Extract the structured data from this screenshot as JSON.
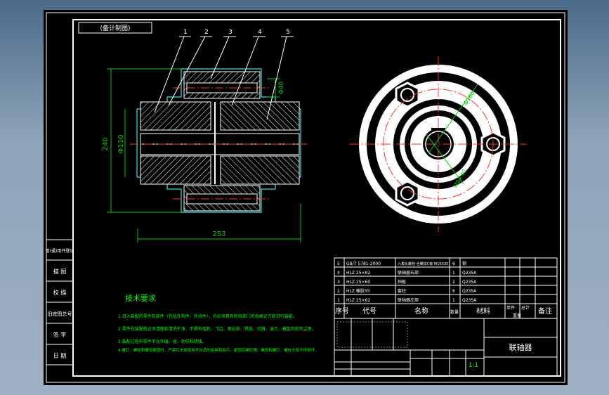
{
  "title_tab": "(备计制图)",
  "balloons": [
    "1",
    "2",
    "3",
    "4",
    "5"
  ],
  "dims": {
    "overall_dia": "240",
    "bore": "Φ110",
    "length": "253",
    "hub": "Φ40",
    "circle": "Φ160",
    "hole": "M8×40"
  },
  "left_stamps": [
    "借(通)用件登记",
    "描 图",
    "校 描",
    "旧底图总号",
    "签 字",
    "日 期"
  ],
  "tech": {
    "heading": "技术要求",
    "lines": [
      "1.进入装配的零件及部件（包括外购件、外协件），均必须具有检验部门的合格证方能进行装配。",
      "2.零件在装配前必须清理和清洗干净，不得有毛刺、飞边、氧化皮、锈蚀、切屑、油污、着色剂和灰尘等。",
      "3.装配过程中零件不允许磕、碰、划伤和锈蚀。",
      "4.螺钉、螺栓和螺母紧固时，严禁打击或使用不合适的旋具和扳手。紧固后螺钉槽、螺母和螺钉、螺栓头部不得损坏。"
    ]
  },
  "bom": {
    "rows": [
      {
        "no": "5",
        "code": "GB/T 5781-2000",
        "name": "六角头螺栓-全螺纹C级 M16X35",
        "qty": "6",
        "mat": "钢"
      },
      {
        "no": "4",
        "code": "HLZ 25×62",
        "name": "联轴器右部",
        "qty": "1",
        "mat": "Q235A"
      },
      {
        "no": "3",
        "code": "HLZ 25×60",
        "name": "挡板",
        "qty": "2",
        "mat": "Q235A"
      },
      {
        "no": "2",
        "code": "HLZ 橡胶55",
        "name": "套柱",
        "qty": "6",
        "mat": "Q235A"
      },
      {
        "no": "1",
        "code": "HLZ 25×62",
        "name": "联轴器左部",
        "qty": "1",
        "mat": "Q235A"
      }
    ],
    "header": {
      "no": "序号",
      "code": "代号",
      "name": "名称",
      "qty": "数量",
      "mat": "材料",
      "unit": "单件",
      "total": "总计",
      "weight": "重量",
      "remark": "备注"
    }
  },
  "title_block": {
    "drawing_name": "联轴器",
    "scale": "1:1"
  }
}
